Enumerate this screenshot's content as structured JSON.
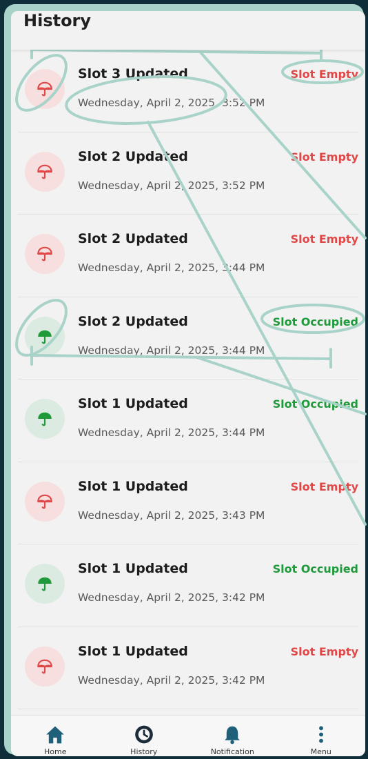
{
  "header": {
    "title": "History"
  },
  "colors": {
    "empty": "#e04848",
    "occupied": "#1f9a3a",
    "accent": "#1e5f7a",
    "annotation": "#a9d3c9"
  },
  "history": [
    {
      "title": "Slot 3 Updated",
      "time": "Wednesday, April 2, 2025, 3:52 PM",
      "status": "Slot Empty",
      "state": "empty",
      "icon": "umbrella-outline-icon"
    },
    {
      "title": "Slot 2 Updated",
      "time": "Wednesday, April 2, 2025, 3:52 PM",
      "status": "Slot Empty",
      "state": "empty",
      "icon": "umbrella-outline-icon"
    },
    {
      "title": "Slot 2 Updated",
      "time": "Wednesday, April 2, 2025, 3:44 PM",
      "status": "Slot Empty",
      "state": "empty",
      "icon": "umbrella-outline-icon"
    },
    {
      "title": "Slot 2 Updated",
      "time": "Wednesday, April 2, 2025, 3:44 PM",
      "status": "Slot Occupied",
      "state": "occupied",
      "icon": "umbrella-filled-icon"
    },
    {
      "title": "Slot 1 Updated",
      "time": "Wednesday, April 2, 2025, 3:44 PM",
      "status": "Slot Occupied",
      "state": "occupied",
      "icon": "umbrella-filled-icon"
    },
    {
      "title": "Slot 1 Updated",
      "time": "Wednesday, April 2, 2025, 3:43 PM",
      "status": "Slot Empty",
      "state": "empty",
      "icon": "umbrella-outline-icon"
    },
    {
      "title": "Slot 1 Updated",
      "time": "Wednesday, April 2, 2025, 3:42 PM",
      "status": "Slot Occupied",
      "state": "occupied",
      "icon": "umbrella-filled-icon"
    },
    {
      "title": "Slot 1 Updated",
      "time": "Wednesday, April 2, 2025, 3:42 PM",
      "status": "Slot Empty",
      "state": "empty",
      "icon": "umbrella-outline-icon"
    }
  ],
  "nav": [
    {
      "name": "home",
      "label": "Home",
      "icon": "home-icon"
    },
    {
      "name": "history",
      "label": "History",
      "icon": "history-icon"
    },
    {
      "name": "notification",
      "label": "Notification",
      "icon": "bell-icon"
    },
    {
      "name": "menu",
      "label": "Menu",
      "icon": "more-vertical-icon"
    }
  ]
}
